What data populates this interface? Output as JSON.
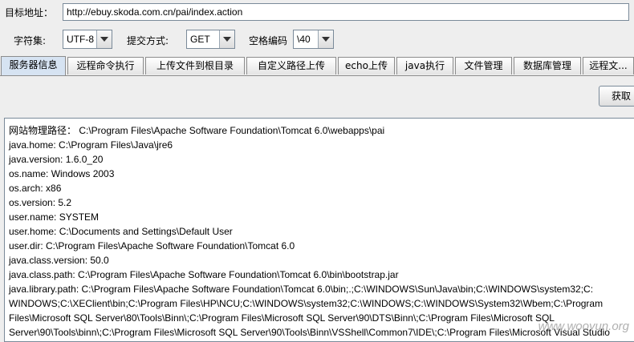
{
  "target": {
    "label": "目标地址：",
    "url": "http://ebuy.skoda.com.cn/pai/index.action"
  },
  "options": {
    "charset_label": "字符集:",
    "charset_value": "UTF-8",
    "method_label": "提交方式:",
    "method_value": "GET",
    "space_label": "空格编码",
    "space_value": "\\40"
  },
  "tabs": [
    {
      "label": "服务器信息",
      "active": true
    },
    {
      "label": "远程命令执行",
      "active": false
    },
    {
      "label": "上传文件到根目录",
      "active": false
    },
    {
      "label": "自定义路径上传",
      "active": false
    },
    {
      "label": "echo上传",
      "active": false
    },
    {
      "label": "java执行",
      "active": false
    },
    {
      "label": "文件管理",
      "active": false
    },
    {
      "label": "数据库管理",
      "active": false
    },
    {
      "label": "远程文...",
      "active": false
    }
  ],
  "panel": {
    "get_button_label": "获取",
    "output_lines": [
      "网站物理路径： C:\\Program Files\\Apache Software Foundation\\Tomcat 6.0\\webapps\\pai",
      "java.home: C:\\Program Files\\Java\\jre6",
      "java.version: 1.6.0_20",
      "os.name: Windows 2003",
      "os.arch: x86",
      "os.version: 5.2",
      "user.name: SYSTEM",
      "user.home: C:\\Documents and Settings\\Default User",
      "user.dir: C:\\Program Files\\Apache Software Foundation\\Tomcat 6.0",
      "java.class.version: 50.0",
      "java.class.path: C:\\Program Files\\Apache Software Foundation\\Tomcat 6.0\\bin\\bootstrap.jar",
      "java.library.path: C:\\Program Files\\Apache Software Foundation\\Tomcat 6.0\\bin;.;C:\\WINDOWS\\Sun\\Java\\bin;C:\\WINDOWS\\system32;C:",
      "WINDOWS;C:\\XEClient\\bin;C:\\Program Files\\HP\\NCU;C:\\WINDOWS\\system32;C:\\WINDOWS;C:\\WINDOWS\\System32\\Wbem;C:\\Program",
      "Files\\Microsoft SQL Server\\80\\Tools\\Binn\\;C:\\Program Files\\Microsoft SQL Server\\90\\DTS\\Binn\\;C:\\Program Files\\Microsoft SQL",
      "Server\\90\\Tools\\binn\\;C:\\Program Files\\Microsoft SQL Server\\90\\Tools\\Binn\\VSShell\\Common7\\IDE\\;C:\\Program Files\\Microsoft Visual Studio"
    ]
  },
  "watermark": "www.wooyun.org"
}
